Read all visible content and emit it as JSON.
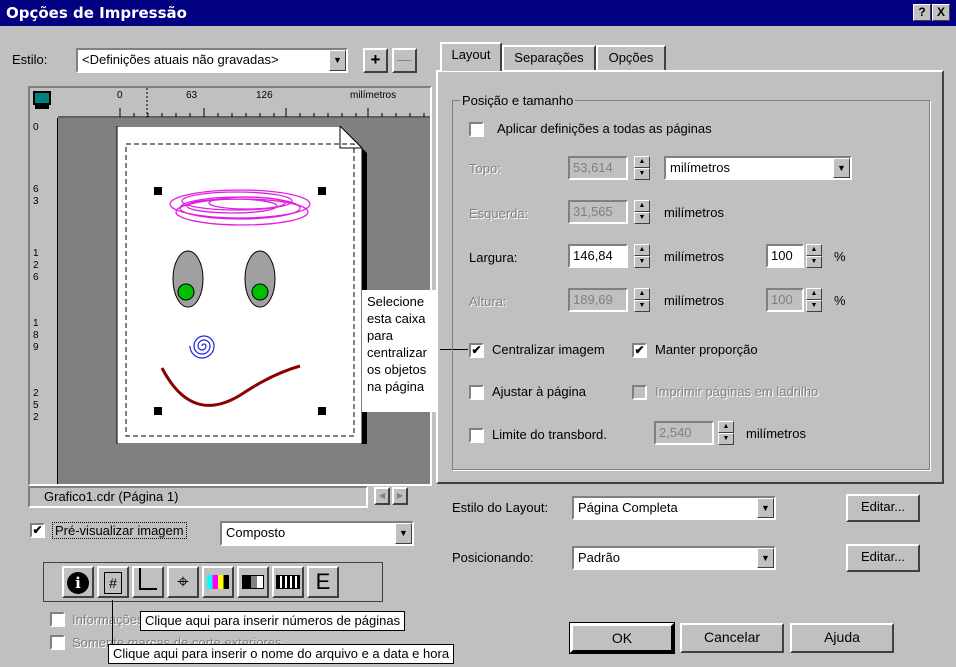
{
  "window": {
    "title": "Opções de Impressão",
    "help_btn": "?",
    "close_btn": "X"
  },
  "style_row": {
    "label": "Estilo:",
    "value": "<Definições atuais não gravadas>",
    "add": "+",
    "remove": "—"
  },
  "ruler": {
    "top_ticks": [
      "0",
      "63",
      "126"
    ],
    "unit": "milímetros",
    "left_ticks": [
      "0",
      "6",
      "3",
      "1",
      "2",
      "6",
      "1",
      "8",
      "9",
      "2",
      "5",
      "2"
    ]
  },
  "callout": {
    "lines": [
      "Selecione",
      "esta caixa",
      "para",
      "centralizar",
      "os objetos",
      "na página"
    ]
  },
  "preview": {
    "status": "Grafico1.cdr (Página 1)",
    "checkbox_label": "Pré-visualizar imagem",
    "mode": "Composto"
  },
  "toolbar": {
    "icons": [
      "info-icon",
      "page-number-icon",
      "filename-date-icon",
      "registration-mark-icon",
      "color-bar-icon",
      "density-scale-icon",
      "crop-mark-icon",
      "emulsion-icon"
    ],
    "page_number_glyph": "#",
    "emulsion_glyph": "E"
  },
  "bottom_checks": {
    "item1": "Informações",
    "item2": "Somente marcas de corte exteriores"
  },
  "tooltips": {
    "page_numbers": "Clique aqui para inserir números de páginas",
    "filename": "Clique aqui para inserir o nome do arquivo e a data e hora"
  },
  "tabs": [
    "Layout",
    "Separações",
    "Opções"
  ],
  "layout": {
    "group_title": "Posição e tamanho",
    "apply_all": "Aplicar definições a todas as páginas",
    "top_label": "Topo:",
    "top_value": "53,614",
    "top_unit": "milímetros",
    "left_label": "Esquerda:",
    "left_value": "31,565",
    "left_unit": "milímetros",
    "width_label": "Largura:",
    "width_value": "146,84",
    "width_unit": "milímetros",
    "width_pct": "100",
    "pct_sign": "%",
    "height_label": "Altura:",
    "height_value": "189,69",
    "height_unit": "milímetros",
    "height_pct": "100",
    "center_label": "Centralizar imagem",
    "center_checked": "✔",
    "keep_ratio_label": "Manter proporção",
    "keep_ratio_checked": "✔",
    "fit_label": "Ajustar à página",
    "tile_label": "Imprimir páginas em ladrilho",
    "bleed_label": "Limite do transbord.",
    "bleed_value": "2,540",
    "bleed_unit": "milímetros",
    "layout_style_label": "Estilo do Layout:",
    "layout_style_value": "Página Completa",
    "edit1": "Editar...",
    "positioning_label": "Posicionando:",
    "positioning_value": "Padrão",
    "edit2": "Editar..."
  },
  "buttons": {
    "ok": "OK",
    "cancel": "Cancelar",
    "help": "Ajuda"
  }
}
